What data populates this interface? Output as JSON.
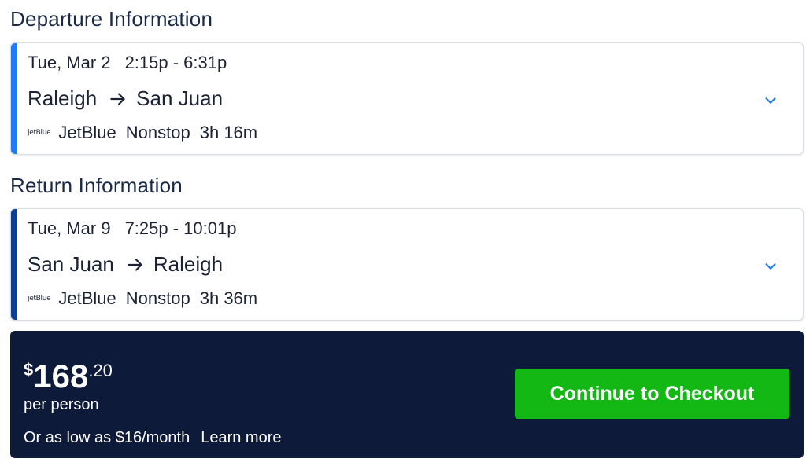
{
  "departure": {
    "title": "Departure Information",
    "date": "Tue, Mar 2",
    "time": "2:15p - 6:31p",
    "origin": "Raleigh",
    "destination": "San Juan",
    "airline_logo": "jetBlue",
    "airline": "JetBlue",
    "stops": "Nonstop",
    "duration": "3h 16m",
    "accent_color": "#1f7cf4"
  },
  "return": {
    "title": "Return Information",
    "date": "Tue, Mar 9",
    "time": "7:25p - 10:01p",
    "origin": "San Juan",
    "destination": "Raleigh",
    "airline_logo": "jetBlue",
    "airline": "JetBlue",
    "stops": "Nonstop",
    "duration": "3h 36m",
    "accent_color": "#0d3f97"
  },
  "price": {
    "currency": "$",
    "whole": "168",
    "cents": ".20",
    "per_person": "per person",
    "financing": "Or as low as $16/month",
    "learn_more": "Learn more",
    "checkout_label": "Continue to Checkout",
    "panel_color": "#0d1a3a",
    "button_color": "#14b814"
  },
  "icons": {
    "arrow": "arrow-right-icon",
    "expand": "chevron-down-icon"
  }
}
